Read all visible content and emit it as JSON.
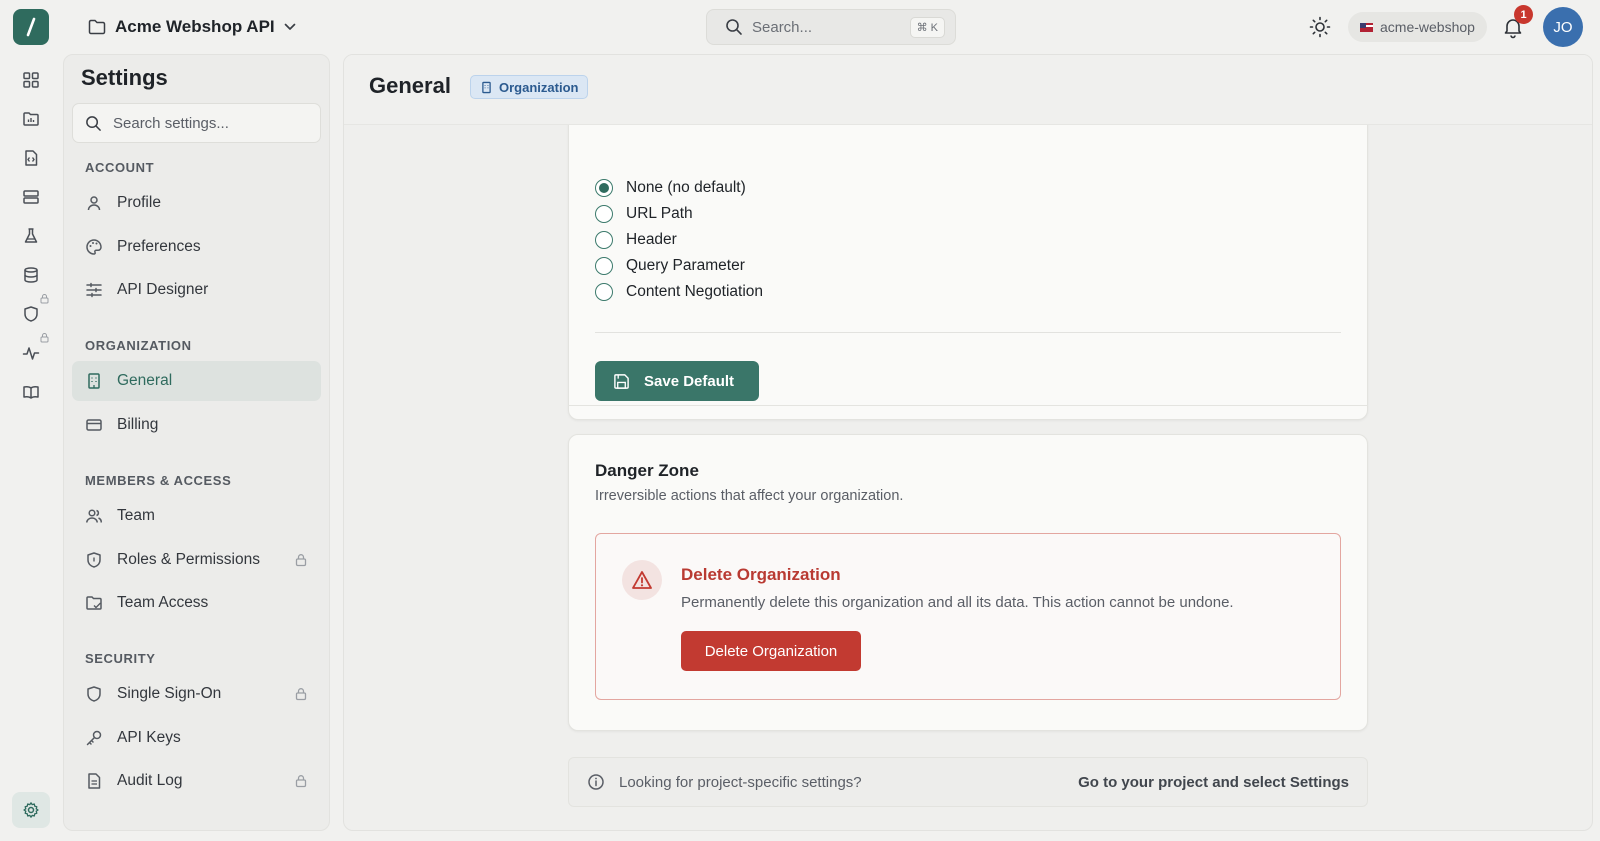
{
  "topbar": {
    "project_name": "Acme Webshop API",
    "search_placeholder": "Search...",
    "search_shortcut": "⌘ K",
    "org_slug": "acme-webshop",
    "notification_count": "1",
    "avatar_initials": "JO"
  },
  "sidebar": {
    "title": "Settings",
    "search_placeholder": "Search settings...",
    "sections": {
      "account": "ACCOUNT",
      "organization": "ORGANIZATION",
      "members": "MEMBERS & ACCESS",
      "security": "SECURITY"
    },
    "items": {
      "profile": "Profile",
      "preferences": "Preferences",
      "api_designer": "API Designer",
      "general": "General",
      "billing": "Billing",
      "team": "Team",
      "roles": "Roles & Permissions",
      "team_access": "Team Access",
      "sso": "Single Sign-On",
      "api_keys": "API Keys",
      "audit_log": "Audit Log"
    }
  },
  "main": {
    "title": "General",
    "badge": "Organization",
    "versioning": {
      "options": [
        "None (no default)",
        "URL Path",
        "Header",
        "Query Parameter",
        "Content Negotiation"
      ],
      "selected": "None (no default)",
      "save_label": "Save Default"
    },
    "danger": {
      "title": "Danger Zone",
      "subtitle": "Irreversible actions that affect your organization.",
      "delete_title": "Delete Organization",
      "delete_desc": "Permanently delete this organization and all its data. This action cannot be undone.",
      "delete_button": "Delete Organization"
    },
    "info": {
      "text": "Looking for project-specific settings?",
      "link": "Go to your project and select Settings"
    }
  },
  "colors": {
    "accent": "#2f6b5e",
    "danger": "#c23a31",
    "badge_blue": "#2b5a8f"
  }
}
